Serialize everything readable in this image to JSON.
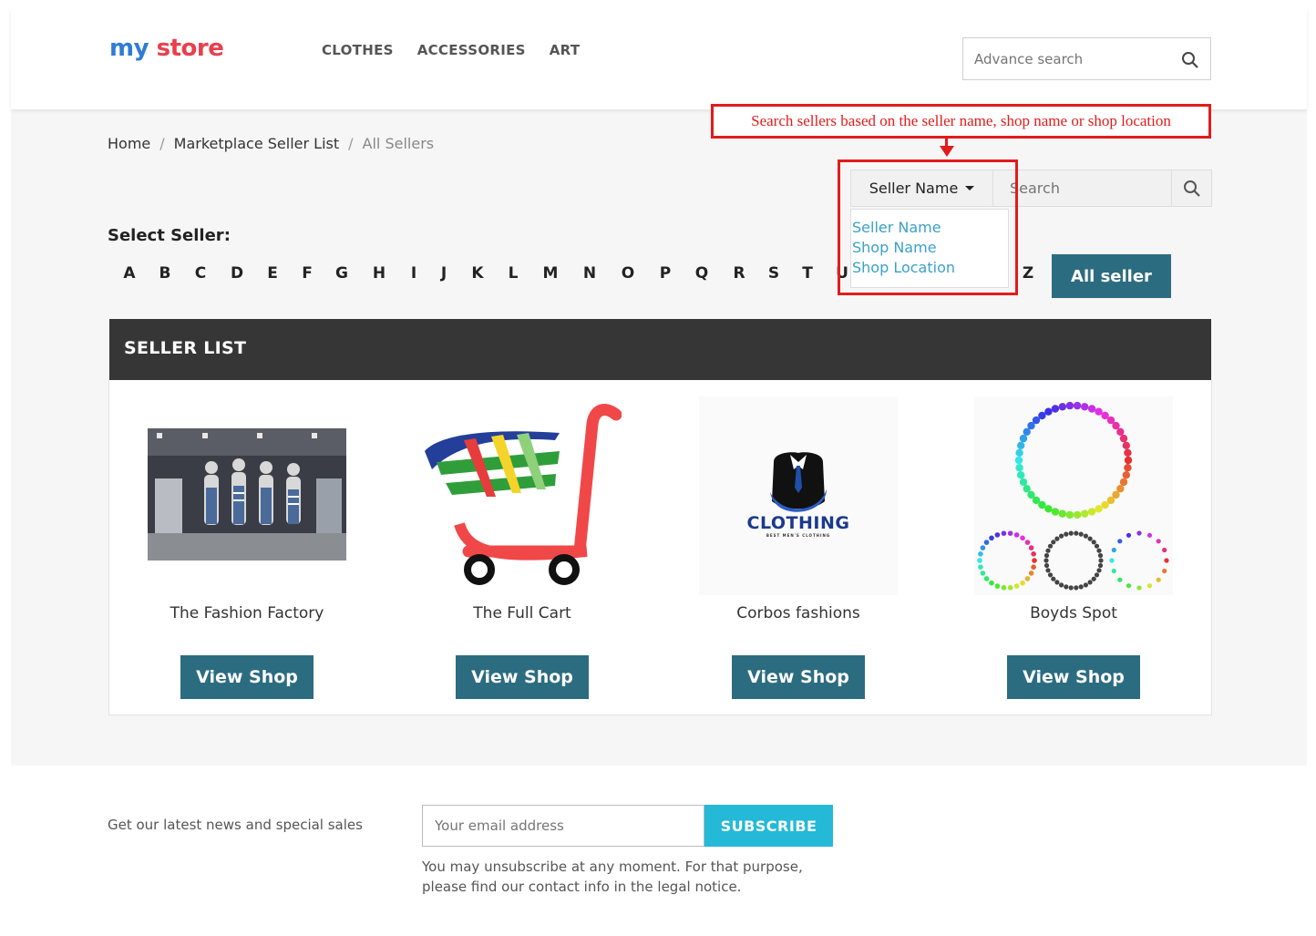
{
  "header": {
    "logo_my": "my",
    "logo_store": "store",
    "nav": [
      "CLOTHES",
      "ACCESSORIES",
      "ART"
    ],
    "search_placeholder": "Advance search"
  },
  "breadcrumb": {
    "home": "Home",
    "list": "Marketplace Seller List",
    "current": "All Sellers",
    "separator": "/"
  },
  "annotation": {
    "text": "Search sellers based on the seller name, shop name or shop location"
  },
  "seller_search": {
    "selected": "Seller Name",
    "placeholder": "Search",
    "options": [
      "Seller Name",
      "Shop Name",
      "Shop Location"
    ]
  },
  "select_seller": {
    "label": "Select Seller:",
    "letters": [
      "A",
      "B",
      "C",
      "D",
      "E",
      "F",
      "G",
      "H",
      "I",
      "J",
      "K",
      "L",
      "M",
      "N",
      "O",
      "P",
      "Q",
      "R",
      "S",
      "T",
      "U",
      "Z"
    ],
    "all_button": "All seller"
  },
  "seller_list": {
    "title": "SELLER LIST",
    "sellers": [
      {
        "name": "The Fashion Factory",
        "button": "View Shop",
        "image": "store-mannequins-image"
      },
      {
        "name": "The Full Cart",
        "button": "View Shop",
        "image": "shopping-cart-logo"
      },
      {
        "name": "Corbos fashions",
        "button": "View Shop",
        "image": "clothing-suit-logo",
        "logo_text": "CLOTHING",
        "logo_subtext": "BEST MEN'S CLOTHING"
      },
      {
        "name": "Boyds Spot",
        "button": "View Shop",
        "image": "dotted-circles-logo"
      }
    ]
  },
  "footer": {
    "newsletter_text": "Get our latest news and special sales",
    "email_placeholder": "Your email address",
    "subscribe_label": "SUBSCRIBE",
    "unsubscribe_text": "You may unsubscribe at any moment. For that purpose, please find our contact info in the legal notice."
  },
  "colors": {
    "primary_button": "#2c6c80",
    "subscribe": "#24b9d7",
    "annotation_red": "#e31b1b",
    "dropdown_link": "#3aa1c9",
    "seller_header": "#363636"
  }
}
